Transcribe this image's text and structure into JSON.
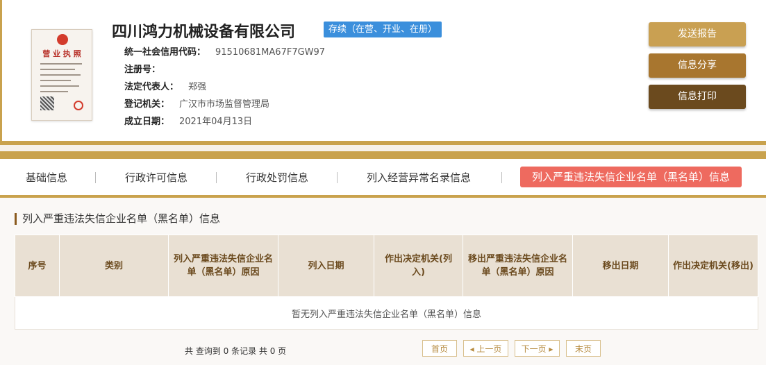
{
  "header": {
    "company_name": "四川鸿力机械设备有限公司",
    "status": "存续（在营、开业、在册）",
    "license_title": "营 业 执 照",
    "fields": [
      {
        "label": "统一社会信用代码：",
        "value": "91510681MA67F7GW97"
      },
      {
        "label": "注册号：",
        "value": ""
      },
      {
        "label": "法定代表人：",
        "value": "郑强"
      },
      {
        "label": "登记机关：",
        "value": "广汉市市场监督管理局"
      },
      {
        "label": "成立日期：",
        "value": "2021年04月13日"
      }
    ],
    "buttons": {
      "report": "发送报告",
      "share": "信息分享",
      "print": "信息打印"
    }
  },
  "tabs": [
    {
      "label": "基础信息"
    },
    {
      "label": "行政许可信息"
    },
    {
      "label": "行政处罚信息"
    },
    {
      "label": "列入经营异常名录信息"
    },
    {
      "label": "列入严重违法失信企业名单（黑名单）信息"
    }
  ],
  "section": {
    "title": "列入严重违法失信企业名单（黑名单）信息",
    "columns": [
      "序号",
      "类别",
      "列入严重违法失信企业名单（黑名单）原因",
      "列入日期",
      "作出决定机关(列入)",
      "移出严重违法失信企业名单（黑名单）原因",
      "移出日期",
      "作出决定机关(移出)"
    ],
    "empty_message": "暂无列入严重违法失信企业名单（黑名单）信息"
  },
  "pagination": {
    "summary": "共 查询到 0 条记录 共 0 页",
    "first": "首页",
    "prev": "◂ 上一页",
    "next": "下一页 ▸",
    "last": "末页"
  },
  "colors": {
    "gold": "#c9a24d",
    "status_blue": "#3b8fdc",
    "active_tab": "#ee6a5f",
    "table_header": "#e9e0d3"
  }
}
